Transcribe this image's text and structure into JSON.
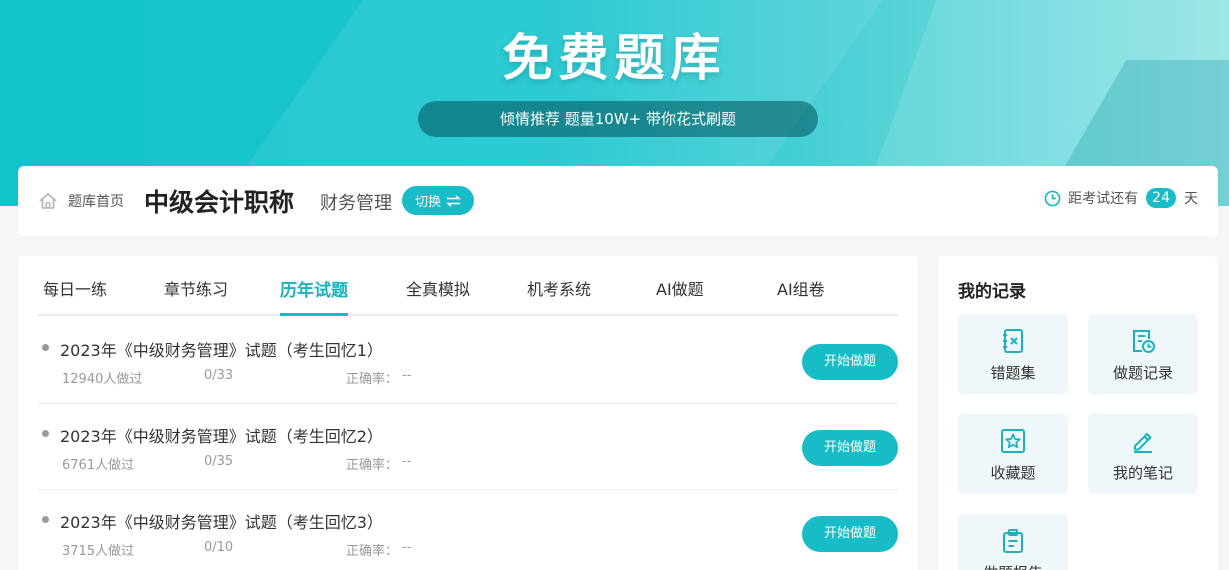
{
  "banner": {
    "title": "免费题库",
    "subtitle": "倾情推荐 题量10W+ 带你花式刷题"
  },
  "infobar": {
    "home_label": "题库首页",
    "exam_title": "中级会计职称",
    "subject": "财务管理",
    "switch_label": "切换",
    "countdown_prefix": "距考试还有",
    "countdown_days": "24",
    "countdown_suffix": "天"
  },
  "tabs": [
    "每日一练",
    "章节练习",
    "历年试题",
    "全真模拟",
    "机考系统",
    "AI做题",
    "AI组卷"
  ],
  "active_tab": 2,
  "papers": [
    {
      "title": "2023年《中级财务管理》试题（考生回忆1）",
      "takers": "12940人做过",
      "progress": "0/33",
      "accuracy_label": "正确率：",
      "accuracy": "--",
      "button": "开始做题"
    },
    {
      "title": "2023年《中级财务管理》试题（考生回忆2）",
      "takers": "6761人做过",
      "progress": "0/35",
      "accuracy_label": "正确率：",
      "accuracy": "--",
      "button": "开始做题"
    },
    {
      "title": "2023年《中级财务管理》试题（考生回忆3）",
      "takers": "3715人做过",
      "progress": "0/10",
      "accuracy_label": "正确率：",
      "accuracy": "--",
      "button": "开始做题"
    }
  ],
  "records": {
    "title": "我的记录",
    "items": [
      {
        "label": "错题集",
        "icon": "wrong-book-icon"
      },
      {
        "label": "做题记录",
        "icon": "history-icon"
      },
      {
        "label": "收藏题",
        "icon": "star-icon"
      },
      {
        "label": "我的笔记",
        "icon": "pencil-icon"
      },
      {
        "label": "做题报告",
        "icon": "report-icon"
      }
    ]
  },
  "colors": {
    "accent": "#18bcc6",
    "accent_text": "#18b3bd",
    "tile_bg": "#f0f7fb"
  }
}
